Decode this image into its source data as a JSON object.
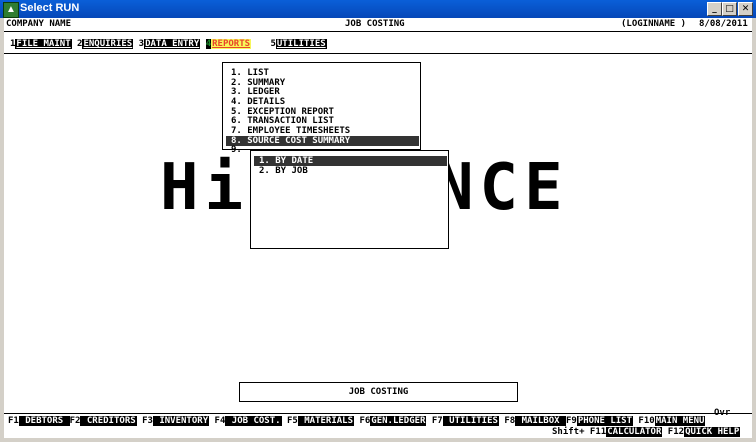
{
  "window": {
    "title": "Select RUN",
    "app_icon": "green-app-icon",
    "controls": [
      "_",
      "□",
      "✕"
    ]
  },
  "header": {
    "company": "COMPANY NAME",
    "module": "JOB COSTING",
    "login": "(LOGINNAME )",
    "date": "8/08/2011"
  },
  "menubar": [
    {
      "num": "1",
      "label": "FILE MAINT"
    },
    {
      "num": "2",
      "label": "ENQUIRIES"
    },
    {
      "num": "3",
      "label": "DATA ENTRY"
    },
    {
      "num": "4",
      "label": "REPORTS",
      "selected": true
    },
    {
      "num": "5",
      "label": "UTILITIES"
    }
  ],
  "logo": {
    "left": "Hi",
    "right": "NCE"
  },
  "reports_menu": {
    "items": [
      {
        "label": "1. LIST"
      },
      {
        "label": "2. SUMMARY"
      },
      {
        "label": "3. LEDGER"
      },
      {
        "label": "4. DETAILS"
      },
      {
        "label": "5. EXCEPTION REPORT"
      },
      {
        "label": "6. TRANSACTION LIST"
      },
      {
        "label": "7. EMPLOYEE TIMESHEETS"
      },
      {
        "label": "8. SOURCE COST SUMMARY",
        "selected": true
      },
      {
        "label": "9."
      }
    ]
  },
  "submenu": {
    "items": [
      {
        "label": "1. BY DATE",
        "selected": true
      },
      {
        "label": "2. BY JOB"
      }
    ]
  },
  "status": {
    "text": "JOB COSTING",
    "mode": "Ovr"
  },
  "fkeys_row1": [
    {
      "key": "F1",
      "label": " DEBTORS "
    },
    {
      "key": "F2",
      "label": " CREDITORS"
    },
    {
      "key": "F3",
      "label": " INVENTORY"
    },
    {
      "key": "F4",
      "label": " JOB COST."
    },
    {
      "key": "F5",
      "label": " MATERIALS"
    },
    {
      "key": "F6",
      "label": "GEN.LEDGER"
    },
    {
      "key": "F7",
      "label": " UTILITIES"
    },
    {
      "key": "F8",
      "label": "  MAILBOX "
    },
    {
      "key": "F9",
      "label": "PHONE LIST"
    },
    {
      "key": "F10",
      "label": "MAIN MENU"
    }
  ],
  "fkeys_row2": [
    {
      "key": "Shift+ F11",
      "label": "CALCULATOR"
    },
    {
      "key": "F12",
      "label": "QUICK HELP"
    }
  ]
}
